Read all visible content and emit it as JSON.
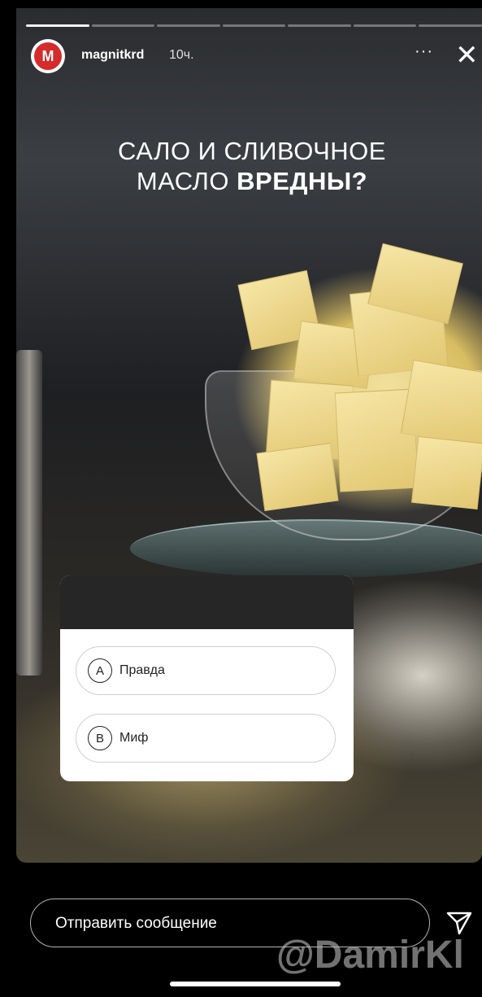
{
  "story": {
    "progress_segments": 7,
    "progress_done": 1,
    "user": {
      "avatar_letter": "М",
      "username": "magnitkrd",
      "time": "10ч."
    },
    "more_label": "···",
    "close_label": "✕",
    "title_line1": "САЛО И СЛИВОЧНОЕ",
    "title_line2_a": "МАСЛО ",
    "title_line2_b": "ВРЕДНЫ?"
  },
  "quiz": {
    "options": [
      {
        "letter": "A",
        "label": "Правда"
      },
      {
        "letter": "B",
        "label": "Миф"
      }
    ]
  },
  "composer": {
    "placeholder": "Отправить сообщение"
  },
  "watermark": "@DamirKl",
  "colors": {
    "brand": "#d52b2b",
    "quiz_header": "#262626"
  },
  "icons": [
    "avatar-logo-icon",
    "more-icon",
    "close-icon",
    "send-icon"
  ]
}
